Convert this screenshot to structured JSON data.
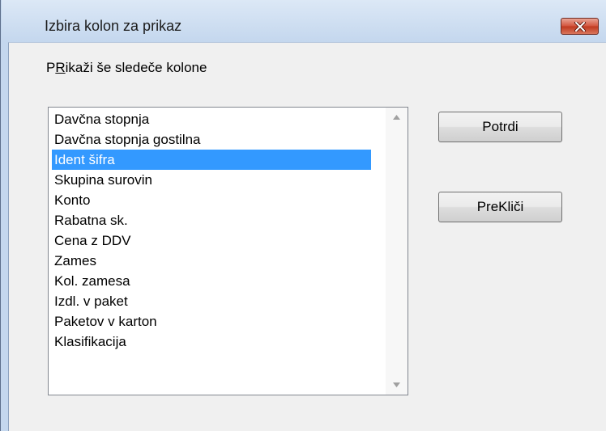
{
  "window": {
    "title": "Izbira kolon za prikaz"
  },
  "dialog": {
    "prompt_part1": "P",
    "prompt_mnemonic": "R",
    "prompt_part2": "ikaži še sledeče kolone",
    "columns": [
      {
        "label": "Davčna stopnja",
        "selected": false
      },
      {
        "label": "Davčna stopnja gostilna",
        "selected": false
      },
      {
        "label": "Ident šifra",
        "selected": true
      },
      {
        "label": "Skupina surovin",
        "selected": false
      },
      {
        "label": "Konto",
        "selected": false
      },
      {
        "label": "Rabatna sk.",
        "selected": false
      },
      {
        "label": "Cena z DDV",
        "selected": false
      },
      {
        "label": "Zames",
        "selected": false
      },
      {
        "label": "Kol. zamesa",
        "selected": false
      },
      {
        "label": "Izdl. v paket",
        "selected": false
      },
      {
        "label": "Paketov v karton",
        "selected": false
      },
      {
        "label": "Klasifikacija",
        "selected": false
      }
    ],
    "confirm_label": "Potrdi",
    "cancel_label": "PreKliči"
  },
  "colors": {
    "selection": "#3399ff",
    "close_button": "#c0391f"
  },
  "icons": {
    "close": "close-x-icon",
    "scroll_up": "scroll-up-arrow-icon",
    "scroll_down": "scroll-down-arrow-icon"
  }
}
